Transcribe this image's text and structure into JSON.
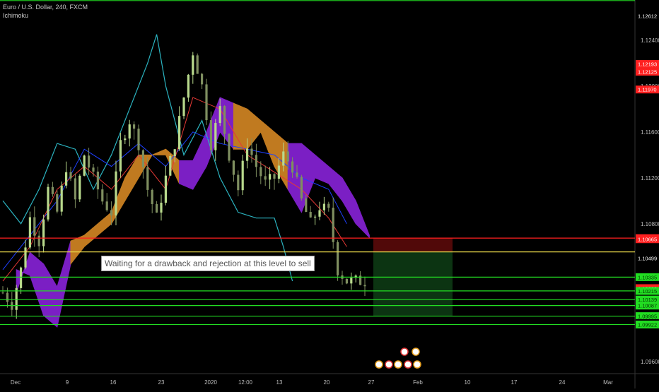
{
  "header": {
    "symbol": "Euro / U.S. Dollar, 240, FXCM",
    "indicator": "Ichimoku"
  },
  "annotation": "Waiting for a drawback and rejection at this level to sell",
  "colors": {
    "background": "#000000",
    "candle_up": "#b8d98c",
    "candle_down": "#7f8f60",
    "tenkan": "#e53935",
    "kijun": "#1e40ff",
    "chikou": "#2bb3c0",
    "kumo_bull": "#c07a20",
    "kumo_bear": "#7b1fc4",
    "level_red": "#ff2020",
    "level_yellow": "#e8d84a",
    "level_green": "#22dd22",
    "short_stop_zone": "#5a0a0a",
    "short_target_zone": "#0d3a14"
  },
  "chart_data": {
    "type": "candlestick",
    "indicator": "Ichimoku",
    "x_ticks": [
      "Dec",
      "9",
      "16",
      "23",
      "2020",
      "12:00",
      "13",
      "20",
      "27",
      "Feb",
      "10",
      "17",
      "24",
      "Mar"
    ],
    "y_ticks": [
      "1.12400",
      "1.12000",
      "1.11600",
      "1.11200",
      "1.10800",
      "1.09600"
    ],
    "ylim": [
      1.095,
      1.1275
    ],
    "price_labels": [
      {
        "value": "1.12612",
        "style": "plain"
      },
      {
        "value": "1.12193",
        "style": "red"
      },
      {
        "value": "1.12125",
        "style": "red"
      },
      {
        "value": "1.11970",
        "style": "red"
      },
      {
        "value": "1.10675",
        "style": "red"
      },
      {
        "value": "1.10665",
        "style": "red"
      },
      {
        "value": "1.10499",
        "style": "plain"
      },
      {
        "value": "1.10335",
        "style": "green"
      },
      {
        "value": "1.10239",
        "style": "red"
      },
      {
        "value": "1.10215",
        "style": "green"
      },
      {
        "value": "1.10139",
        "style": "green"
      },
      {
        "value": "1.10087",
        "style": "green"
      },
      {
        "value": "1.09995",
        "style": "green"
      },
      {
        "value": "1.09935",
        "style": "plain"
      },
      {
        "value": "1.09922",
        "style": "green"
      }
    ],
    "horizontal_levels": [
      {
        "value": 1.12745,
        "color": "green"
      },
      {
        "value": 1.10675,
        "color": "red"
      },
      {
        "value": 1.10555,
        "color": "yellow"
      },
      {
        "value": 1.10335,
        "color": "green"
      },
      {
        "value": 1.10215,
        "color": "green"
      },
      {
        "value": 1.10139,
        "color": "green"
      },
      {
        "value": 1.10087,
        "color": "green"
      },
      {
        "value": 1.09995,
        "color": "green"
      },
      {
        "value": 1.09922,
        "color": "green"
      }
    ],
    "short_position": {
      "entry": 1.10555,
      "stop": 1.10675,
      "target": 1.09995
    },
    "price_path": [
      [
        0,
        1.102
      ],
      [
        2,
        1.101
      ],
      [
        4,
        1.104
      ],
      [
        6,
        1.1085
      ],
      [
        8,
        1.1065
      ],
      [
        10,
        1.111
      ],
      [
        12,
        1.109
      ],
      [
        14,
        1.113
      ],
      [
        16,
        1.11
      ],
      [
        18,
        1.114
      ],
      [
        20,
        1.112
      ],
      [
        22,
        1.11
      ],
      [
        24,
        1.109
      ],
      [
        26,
        1.115
      ],
      [
        28,
        1.117
      ],
      [
        30,
        1.115
      ],
      [
        32,
        1.111
      ],
      [
        34,
        1.1085
      ],
      [
        36,
        1.112
      ],
      [
        38,
        1.115
      ],
      [
        40,
        1.119
      ],
      [
        42,
        1.123
      ],
      [
        44,
        1.12
      ],
      [
        46,
        1.115
      ],
      [
        48,
        1.118
      ],
      [
        50,
        1.114
      ],
      [
        52,
        1.111
      ],
      [
        54,
        1.115
      ],
      [
        56,
        1.113
      ],
      [
        58,
        1.1115
      ],
      [
        60,
        1.112
      ],
      [
        62,
        1.114
      ],
      [
        64,
        1.113
      ],
      [
        66,
        1.11
      ],
      [
        68,
        1.108
      ],
      [
        70,
        1.1095
      ],
      [
        72,
        1.109
      ],
      [
        74,
        1.104
      ],
      [
        76,
        1.103
      ]
    ],
    "tenkan": [
      [
        0,
        1.103
      ],
      [
        6,
        1.106
      ],
      [
        12,
        1.111
      ],
      [
        18,
        1.113
      ],
      [
        24,
        1.111
      ],
      [
        30,
        1.114
      ],
      [
        36,
        1.111
      ],
      [
        42,
        1.119
      ],
      [
        48,
        1.118
      ],
      [
        54,
        1.114
      ],
      [
        60,
        1.1125
      ],
      [
        66,
        1.111
      ],
      [
        72,
        1.1085
      ],
      [
        76,
        1.106
      ]
    ],
    "kijun": [
      [
        0,
        1.104
      ],
      [
        6,
        1.107
      ],
      [
        12,
        1.11
      ],
      [
        18,
        1.1145
      ],
      [
        24,
        1.113
      ],
      [
        30,
        1.115
      ],
      [
        36,
        1.113
      ],
      [
        42,
        1.116
      ],
      [
        48,
        1.115
      ],
      [
        54,
        1.1145
      ],
      [
        60,
        1.114
      ],
      [
        66,
        1.112
      ],
      [
        72,
        1.111
      ],
      [
        76,
        1.108
      ]
    ],
    "chikou": [
      [
        0,
        1.11
      ],
      [
        4,
        1.108
      ],
      [
        8,
        1.111
      ],
      [
        12,
        1.115
      ],
      [
        16,
        1.1145
      ],
      [
        20,
        1.111
      ],
      [
        24,
        1.114
      ],
      [
        28,
        1.118
      ],
      [
        32,
        1.122
      ],
      [
        34,
        1.1245
      ],
      [
        36,
        1.12
      ],
      [
        40,
        1.114
      ],
      [
        44,
        1.117
      ],
      [
        48,
        1.112
      ],
      [
        52,
        1.109
      ],
      [
        56,
        1.1085
      ],
      [
        60,
        1.1085
      ],
      [
        62,
        1.106
      ],
      [
        64,
        1.103
      ]
    ],
    "kumo": {
      "x": [
        3,
        6,
        9,
        12,
        15,
        18,
        21,
        24,
        27,
        30,
        33,
        36,
        39,
        42,
        45,
        48,
        51,
        54,
        57,
        60,
        63,
        66,
        69,
        72,
        75,
        78,
        81
      ],
      "upper": [
        1.102,
        1.1055,
        1.1045,
        1.1025,
        1.1065,
        1.107,
        1.108,
        1.109,
        1.112,
        1.114,
        1.114,
        1.1145,
        1.1135,
        1.1135,
        1.116,
        1.119,
        1.1185,
        1.118,
        1.117,
        1.116,
        1.115,
        1.115,
        1.114,
        1.113,
        1.112,
        1.11,
        1.107
      ],
      "lower": [
        1.104,
        1.1035,
        1.1,
        1.099,
        1.1045,
        1.106,
        1.107,
        1.108,
        1.11,
        1.112,
        1.114,
        1.114,
        1.1115,
        1.111,
        1.113,
        1.116,
        1.1145,
        1.1145,
        1.116,
        1.113,
        1.111,
        1.109,
        1.112,
        1.1115,
        1.11,
        1.108,
        1.1068
      ],
      "segments": [
        {
          "from": 0,
          "to": 4,
          "color": "bear"
        },
        {
          "from": 4,
          "to": 12,
          "color": "bull"
        },
        {
          "from": 12,
          "to": 16,
          "color": "bear"
        },
        {
          "from": 16,
          "to": 20,
          "color": "bull"
        },
        {
          "from": 20,
          "to": 26,
          "color": "bear"
        }
      ]
    }
  }
}
